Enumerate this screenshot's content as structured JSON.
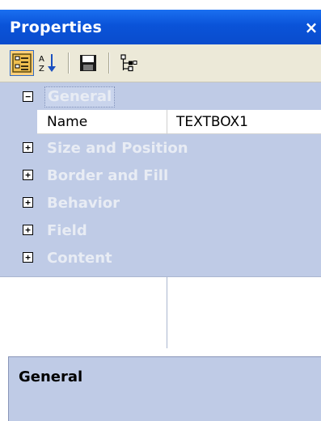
{
  "window": {
    "title": "Properties",
    "close_glyph": "×"
  },
  "toolbar": {
    "buttons": [
      {
        "name": "categorized-view-icon",
        "active": true
      },
      {
        "name": "alphabetical-sort-icon",
        "active": false
      },
      {
        "name": "save-icon",
        "active": false
      },
      {
        "name": "hierarchy-tree-icon",
        "active": false
      }
    ]
  },
  "grid": {
    "categories": [
      {
        "label": "General",
        "expanded": true,
        "selected": true,
        "expander": "−"
      },
      {
        "label": "Size and Position",
        "expanded": false,
        "expander": "+"
      },
      {
        "label": "Border and Fill",
        "expanded": false,
        "expander": "+"
      },
      {
        "label": "Behavior",
        "expanded": false,
        "expander": "+"
      },
      {
        "label": "Field",
        "expanded": false,
        "expander": "+"
      },
      {
        "label": "Content",
        "expanded": false,
        "expander": "+"
      }
    ],
    "properties": [
      {
        "name": "Name",
        "value": "TEXTBOX1"
      }
    ]
  },
  "description": {
    "title": "General"
  },
  "colors": {
    "titlebar": "#0a53d8",
    "grid_background": "#bfcbe6",
    "category_text": "#e8ecf4",
    "toolbar_background": "#ece9d8",
    "active_button": "#ffcf7a"
  }
}
